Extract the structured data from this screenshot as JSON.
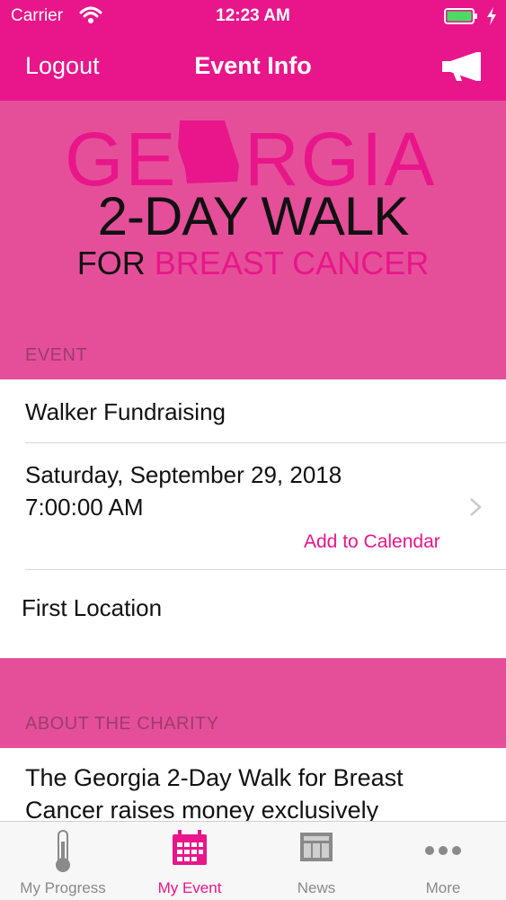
{
  "status": {
    "carrier": "Carrier",
    "time": "12:23 AM"
  },
  "nav": {
    "left_label": "Logout",
    "title": "Event Info",
    "right_icon": "megaphone-icon"
  },
  "hero": {
    "line1": "GEORGIA",
    "line2": "2-DAY WALK",
    "line3_a": "FOR",
    "line3_b": "BREAST CANCER",
    "accent_color": "#e8168a",
    "background_color": "#e54f9a"
  },
  "event_section": {
    "header": "EVENT",
    "rows": {
      "name": "Walker Fundraising",
      "date": "Saturday, September 29, 2018",
      "time": "7:00:00 AM",
      "add_calendar": "Add to Calendar",
      "location": "First Location"
    }
  },
  "about_section": {
    "header": "ABOUT THE CHARITY",
    "text_line1": "The Georgia 2-Day Walk for Breast",
    "text_line2": "Cancer raises money exclusively"
  },
  "tabs": [
    {
      "label": "My Progress",
      "icon": "thermometer-icon",
      "active": false
    },
    {
      "label": "My Event",
      "icon": "calendar-icon",
      "active": true
    },
    {
      "label": "News",
      "icon": "newspaper-icon",
      "active": false
    },
    {
      "label": "More",
      "icon": "more-dots-icon",
      "active": false
    }
  ]
}
